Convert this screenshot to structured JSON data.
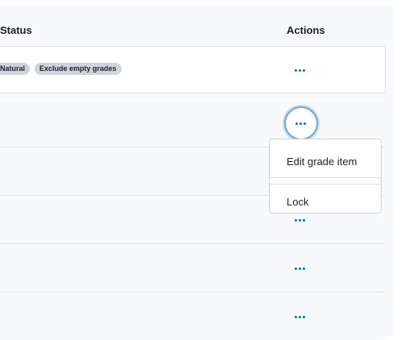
{
  "table": {
    "headers": {
      "status": "Status",
      "actions": "Actions"
    },
    "first_row_badges": [
      "Natural",
      "Exclude empty grades"
    ]
  },
  "actions_menu": {
    "items": [
      "Edit grade item",
      "Lock"
    ]
  },
  "icons": {
    "actions": "more-horizontal-icon"
  },
  "colors": {
    "accent": "#0f6cbf",
    "badge_bg": "#ced4da",
    "panel_bg": "#f8f9fa"
  }
}
